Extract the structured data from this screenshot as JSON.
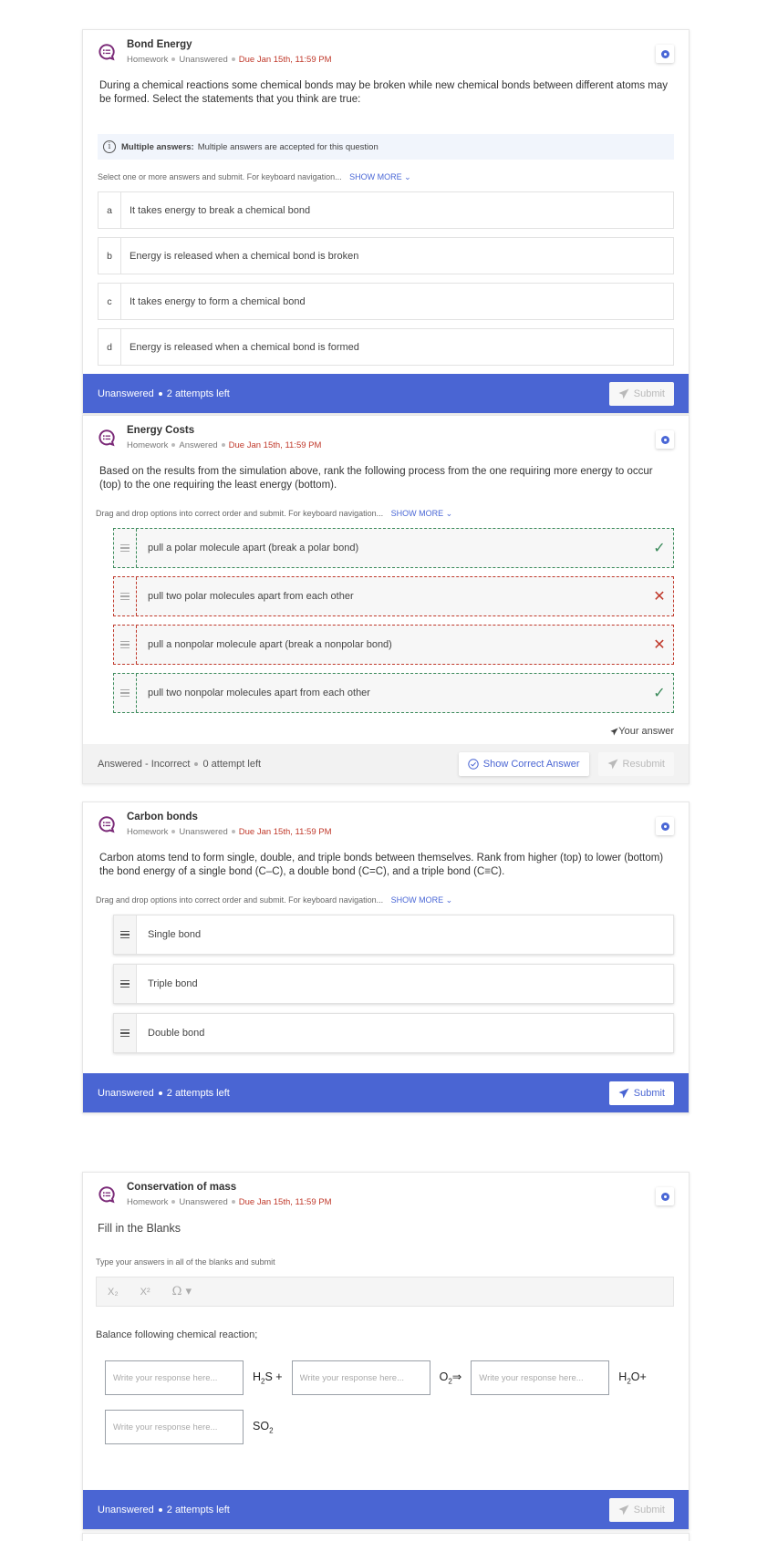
{
  "colors": {
    "accent": "#4a65d3",
    "due": "#c0392b",
    "correct": "#3a8a5a",
    "incorrect": "#c0392b",
    "question_icon": "#7b2a78"
  },
  "questions": [
    {
      "title": "Bond Energy",
      "meta": {
        "type": "Homework",
        "status": "Unanswered",
        "due": "Due Jan 15th, 11:59 PM"
      },
      "text": "During a chemical reactions some chemical bonds may be broken while new chemical bonds between different atoms may be formed. Select the statements that you think are true:",
      "info": {
        "label": "Multiple answers:",
        "text": "Multiple answers are accepted for this question"
      },
      "hint": "Select one or more answers and submit. For keyboard navigation...",
      "show_more": "SHOW MORE",
      "options": [
        {
          "letter": "a",
          "text": "It takes energy to break a chemical bond"
        },
        {
          "letter": "b",
          "text": "Energy is released when a chemical bond is broken"
        },
        {
          "letter": "c",
          "text": "It takes energy to form a chemical bond"
        },
        {
          "letter": "d",
          "text": "Energy is released when a chemical bond is formed"
        }
      ],
      "footer": {
        "status": "Unanswered",
        "attempts": "2 attempts left",
        "submit": "Submit"
      }
    },
    {
      "title": "Energy Costs",
      "meta": {
        "type": "Homework",
        "status": "Answered",
        "due": "Due Jan 15th, 11:59 PM"
      },
      "text": "Based on the results from the simulation above, rank the following process from the one requiring more energy to occur (top) to the one requiring the least energy (bottom).",
      "hint": "Drag and drop options into correct order and submit. For keyboard navigation...",
      "show_more": "SHOW MORE",
      "items": [
        {
          "text": "pull a polar molecule apart (break a polar bond)",
          "result": "correct",
          "mark": "✓"
        },
        {
          "text": "pull two polar molecules apart from each other",
          "result": "incorrect",
          "mark": "✕"
        },
        {
          "text": "pull a nonpolar molecule apart (break a nonpolar bond)",
          "result": "incorrect",
          "mark": "✕"
        },
        {
          "text": "pull two nonpolar molecules apart from each other",
          "result": "correct",
          "mark": "✓"
        }
      ],
      "your_answer": "Your answer",
      "footer": {
        "status": "Answered - Incorrect",
        "attempts": "0 attempt left",
        "show_correct": "Show Correct Answer",
        "resubmit": "Resubmit"
      }
    },
    {
      "title": "Carbon bonds",
      "meta": {
        "type": "Homework",
        "status": "Unanswered",
        "due": "Due Jan 15th, 11:59 PM"
      },
      "text": "Carbon atoms tend to form single, double, and triple bonds between themselves. Rank from higher (top) to lower (bottom) the bond energy of a single bond (C–C), a double bond (C=C), and a triple bond (C≡C).",
      "hint": "Drag and drop options into correct order and submit. For keyboard navigation...",
      "show_more": "SHOW MORE",
      "items": [
        {
          "text": "Single bond"
        },
        {
          "text": "Triple bond"
        },
        {
          "text": "Double bond"
        }
      ],
      "footer": {
        "status": "Unanswered",
        "attempts": "2 attempts left",
        "submit": "Submit"
      }
    },
    {
      "title": "Conservation of mass",
      "meta": {
        "type": "Homework",
        "status": "Unanswered",
        "due": "Due Jan 15th, 11:59 PM"
      },
      "subtitle": "Fill in the Blanks",
      "hint": "Type your answers in all of the blanks and submit",
      "toolbar": {
        "subscript": "X₂",
        "superscript": "X²",
        "special_chars": "Ω ▾"
      },
      "prompt": "Balance following chemical reaction;",
      "blank_placeholder": "Write your response here...",
      "equation": {
        "h2s": "S +",
        "o2": "⇒",
        "h2o": "O+",
        "so2": "SO"
      },
      "footer": {
        "status": "Unanswered",
        "attempts": "2 attempts left",
        "submit": "Submit"
      }
    }
  ]
}
